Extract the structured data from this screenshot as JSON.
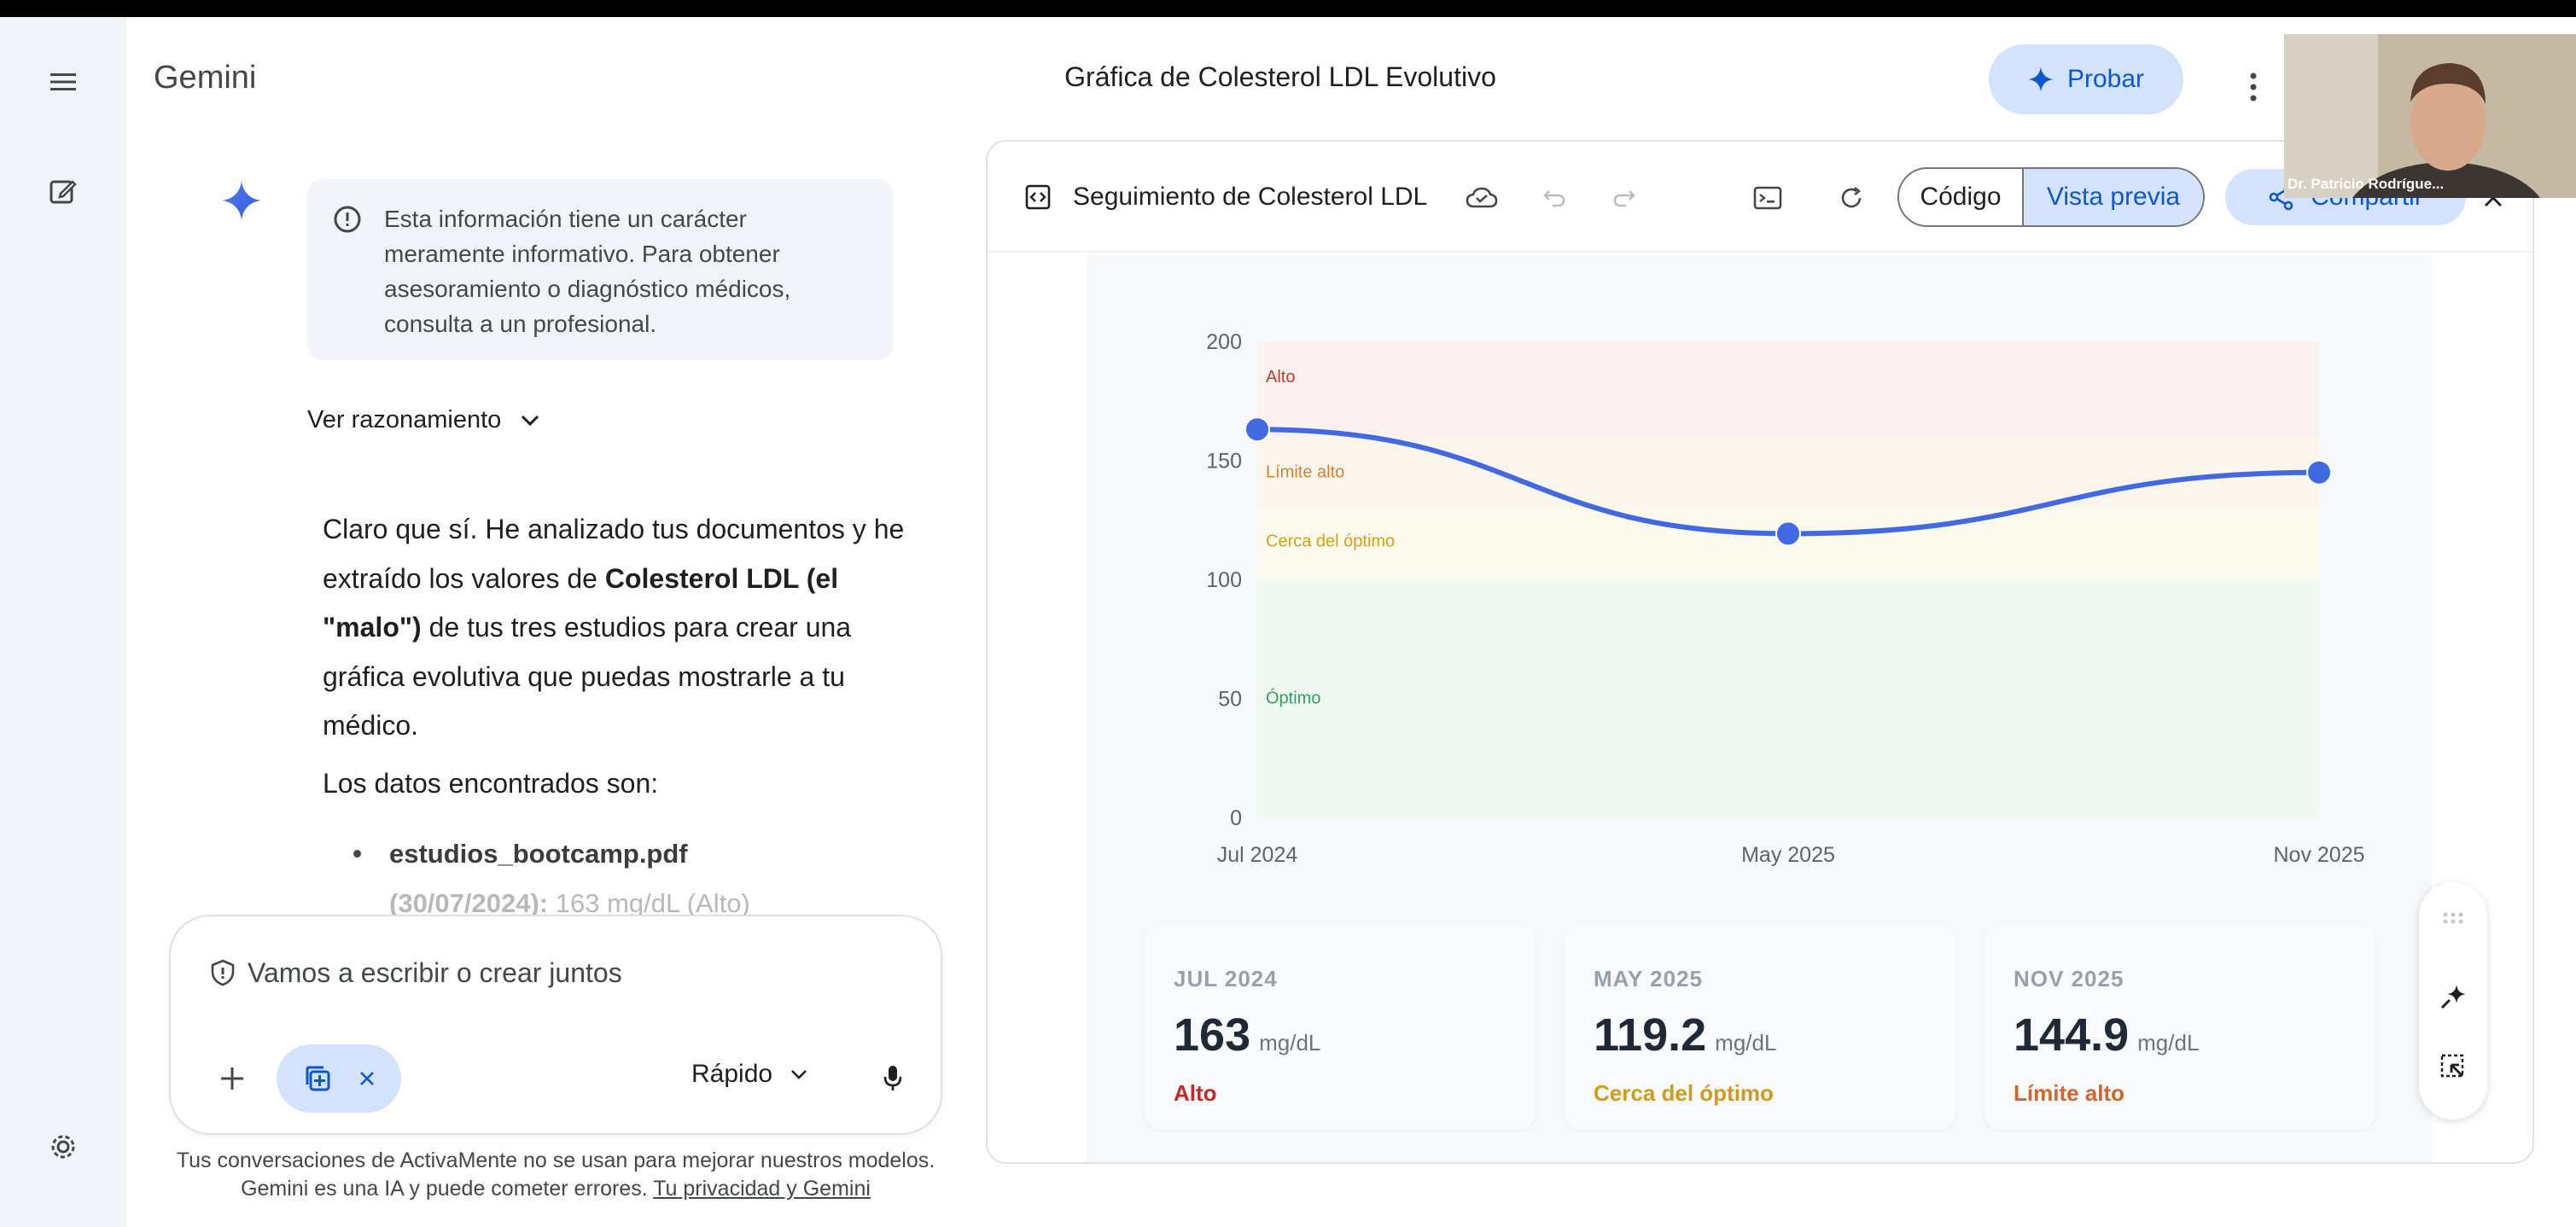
{
  "app": {
    "name": "Gemini",
    "conversation_title": "Gráfica de Colesterol LDL Evolutivo",
    "try_button": "Probar"
  },
  "chat": {
    "disclaimer": "Esta información tiene un carácter meramente informativo. Para obtener asesoramiento o diagnóstico médicos, consulta a un profesional.",
    "show_reasoning": "Ver razonamiento",
    "response": {
      "p1_a": "Claro que sí. He analizado tus documentos y he extraído los valores de ",
      "p1_bold": "Colesterol LDL (el \"malo\")",
      "p1_b": " de tus tres estudios para crear una gráfica evolutiva que puedas mostrarle a tu médico.",
      "p2": "Los datos encontrados son:",
      "bullet_file": "estudios_bootcamp.pdf",
      "bullet_date": "(30/07/2024):",
      "bullet_value": " 163 mg/dL (Alto)"
    }
  },
  "input": {
    "placeholder": "Vamos a escribir o crear juntos",
    "mode": "Rápido"
  },
  "footer": {
    "text": "Tus conversaciones de ActivaMente no se usan para mejorar nuestros modelos. Gemini es una IA y puede cometer errores. ",
    "link": "Tu privacidad y Gemini"
  },
  "canvas": {
    "title": "Seguimiento de Colesterol LDL",
    "tab_code": "Código",
    "tab_preview": "Vista previa",
    "share": "Compartir"
  },
  "chart_data": {
    "type": "line",
    "x": [
      "Jul 2024",
      "May 2025",
      "Nov 2025"
    ],
    "y": [
      163,
      119.2,
      144.9
    ],
    "ylim": [
      0,
      200
    ],
    "yticks": [
      0,
      50,
      100,
      150,
      200
    ],
    "bands": [
      {
        "label": "Alto",
        "from": 160,
        "to": 200,
        "color": "#c0392b"
      },
      {
        "label": "Límite alto",
        "from": 130,
        "to": 160,
        "color": "#d9822b"
      },
      {
        "label": "Cerca del óptimo",
        "from": 100,
        "to": 130,
        "color": "#d4a017"
      },
      {
        "label": "Óptimo",
        "from": 0,
        "to": 100,
        "color": "#2e9e5b"
      }
    ],
    "line_color": "#4169e1"
  },
  "cards": [
    {
      "label": "JUL 2024",
      "value": "163",
      "unit": "mg/dL",
      "status": "Alto",
      "status_color": "#c62828"
    },
    {
      "label": "MAY 2025",
      "value": "119.2",
      "unit": "mg/dL",
      "status": "Cerca del óptimo",
      "status_color": "#d39a1a"
    },
    {
      "label": "NOV 2025",
      "value": "144.9",
      "unit": "mg/dL",
      "status": "Límite alto",
      "status_color": "#d3652a"
    }
  ],
  "webcam": {
    "name": "Dr. Patricio Rodrígue..."
  }
}
